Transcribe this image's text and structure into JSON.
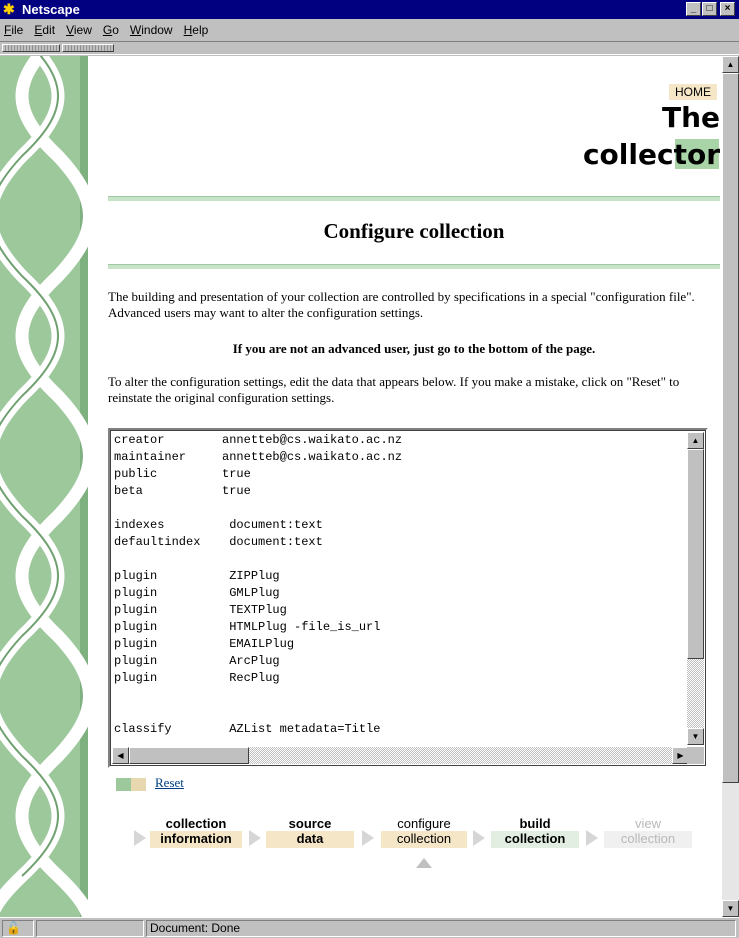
{
  "window": {
    "title": "Netscape"
  },
  "menu": [
    "File",
    "Edit",
    "View",
    "Go",
    "Window",
    "Help"
  ],
  "page": {
    "home_label": "HOME",
    "logo_line1": "The",
    "logo_line2": "collector",
    "title": "Configure collection",
    "intro": "The building and presentation of your collection are controlled by specifications in a special \"configuration file\". Advanced users may want to alter the configuration settings.",
    "warning": "If you are not an advanced user, just go to the bottom of the page.",
    "instructions": "To alter the configuration settings, edit the data that appears below. If you make a mistake, click on \"Reset\" to reinstate the original configuration settings.",
    "config_text": "creator        annetteb@cs.waikato.ac.nz\nmaintainer     annetteb@cs.waikato.ac.nz\npublic         true\nbeta           true\n\nindexes         document:text\ndefaultindex    document:text\n\nplugin          ZIPPlug\nplugin          GMLPlug\nplugin          TEXTPlug\nplugin          HTMLPlug -file_is_url\nplugin          EMAILPlug\nplugin          ArcPlug\nplugin          RecPlug\n\n\nclassify        AZList metadata=Title",
    "reset_label": "Reset"
  },
  "steps": [
    {
      "line1": "collection",
      "line2": "information",
      "state": "done",
      "color": "#f5e6c8"
    },
    {
      "line1": "source",
      "line2": "data",
      "state": "done",
      "color": "#f5e6c8"
    },
    {
      "line1": "configure",
      "line2": "collection",
      "state": "current",
      "color": "#f5e6c8"
    },
    {
      "line1": "build",
      "line2": "collection",
      "state": "next",
      "color": "#e3eee3"
    },
    {
      "line1": "view",
      "line2": "collection",
      "state": "disabled",
      "color": "#f0f0f0"
    }
  ],
  "status": {
    "text": "Document: Done"
  },
  "colors": {
    "accent_green": "#9cc89c",
    "accent_tan": "#f5e6c8",
    "link": "#004080"
  }
}
